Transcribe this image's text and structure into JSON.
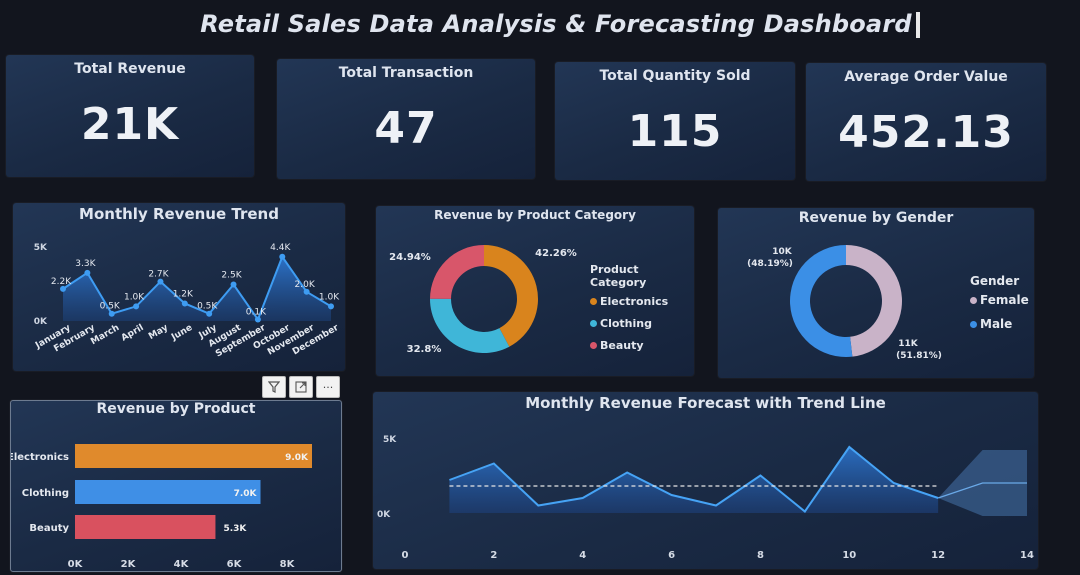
{
  "dashboard": {
    "title": "Retail Sales Data Analysis & Forecasting Dashboard"
  },
  "kpis": [
    {
      "label": "Total Revenue",
      "value": "21K"
    },
    {
      "label": "Total Transaction",
      "value": "47"
    },
    {
      "label": "Total Quantity Sold",
      "value": "115"
    },
    {
      "label": "Average Order Value",
      "value": "452.13"
    }
  ],
  "monthly_trend": {
    "title": "Monthly Revenue Trend",
    "y_ticks": [
      "5K",
      "0K"
    ],
    "months": [
      "January",
      "February",
      "March",
      "April",
      "May",
      "June",
      "July",
      "August",
      "September",
      "October",
      "November",
      "December"
    ],
    "labels": [
      "2.2K",
      "3.3K",
      "0.5K",
      "1.0K",
      "2.7K",
      "1.2K",
      "0.5K",
      "2.5K",
      "0.1K",
      "4.4K",
      "2.0K",
      "1.0K"
    ]
  },
  "category_donut": {
    "title": "Revenue by Product Category",
    "legend_title": "Product Category",
    "items": [
      {
        "name": "Electronics",
        "pct_label": "42.26%",
        "color": "#d9841d"
      },
      {
        "name": "Clothing",
        "pct_label": "32.8%",
        "color": "#3fb6d8"
      },
      {
        "name": "Beauty",
        "pct_label": "24.94%",
        "color": "#d8566a"
      }
    ]
  },
  "gender_donut": {
    "title": "Revenue by Gender",
    "legend_title": "Gender",
    "items": [
      {
        "name": "Female",
        "value_label": "10K",
        "pct_label": "(48.19%)",
        "color": "#c9b3c8"
      },
      {
        "name": "Male",
        "value_label": "11K",
        "pct_label": "(51.81%)",
        "color": "#3b8fe6"
      }
    ]
  },
  "visual_toolbar": {
    "filter": "filter",
    "focus": "focus mode",
    "more": "···"
  },
  "product_bars": {
    "title": "Revenue by Product",
    "x_ticks": [
      "0K",
      "2K",
      "4K",
      "6K",
      "8K"
    ],
    "items": [
      {
        "name": "Electronics",
        "value_label": "9.0K",
        "color": "#e08a2c"
      },
      {
        "name": "Clothing",
        "value_label": "7.0K",
        "color": "#3f8fe6"
      },
      {
        "name": "Beauty",
        "value_label": "5.3K",
        "color": "#d9515f"
      }
    ]
  },
  "forecast": {
    "title": "Monthly Revenue Forecast with Trend Line",
    "y_ticks": [
      "5K",
      "0K"
    ],
    "x_ticks": [
      "0",
      "2",
      "4",
      "6",
      "8",
      "10",
      "12",
      "14"
    ]
  },
  "chart_data": [
    {
      "type": "area",
      "title": "Monthly Revenue Trend",
      "categories": [
        "January",
        "February",
        "March",
        "April",
        "May",
        "June",
        "July",
        "August",
        "September",
        "October",
        "November",
        "December"
      ],
      "values": [
        2.2,
        3.3,
        0.5,
        1.0,
        2.7,
        1.2,
        0.5,
        2.5,
        0.1,
        4.4,
        2.0,
        1.0
      ],
      "ylim": [
        0,
        5
      ]
    },
    {
      "type": "pie",
      "title": "Revenue by Product Category",
      "categories": [
        "Electronics",
        "Clothing",
        "Beauty"
      ],
      "values": [
        42.26,
        32.8,
        24.94
      ]
    },
    {
      "type": "pie",
      "title": "Revenue by Gender",
      "categories": [
        "Female",
        "Male"
      ],
      "values": [
        48.19,
        51.81
      ]
    },
    {
      "type": "bar",
      "title": "Revenue by Product",
      "categories": [
        "Electronics",
        "Clothing",
        "Beauty"
      ],
      "values": [
        9.0,
        7.0,
        5.3
      ],
      "xlim": [
        0,
        8
      ]
    },
    {
      "type": "area",
      "title": "Monthly Revenue Forecast with Trend Line",
      "x": [
        1,
        2,
        3,
        4,
        5,
        6,
        7,
        8,
        9,
        10,
        11,
        12
      ],
      "values": [
        2.2,
        3.3,
        0.5,
        1.0,
        2.7,
        1.2,
        0.5,
        2.5,
        0.1,
        4.4,
        2.0,
        1.0
      ],
      "trend_value": 1.8,
      "forecast_x": [
        12,
        13,
        14
      ],
      "forecast_upper": [
        1.0,
        4.2,
        4.2
      ],
      "forecast_lower": [
        1.0,
        -0.2,
        -0.2
      ],
      "forecast_mid": [
        1.0,
        2.0,
        2.0
      ],
      "xlim": [
        0,
        14
      ],
      "ylim": [
        0,
        5
      ]
    }
  ]
}
